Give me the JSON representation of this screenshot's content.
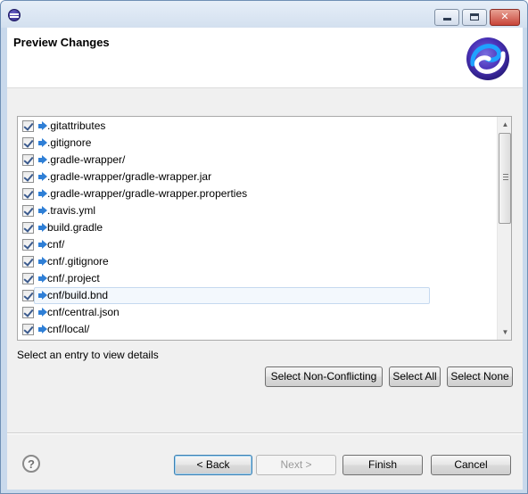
{
  "window": {
    "close_glyph": "✕",
    "title_icon": "eclipse-icon",
    "controls": [
      "minimize",
      "maximize",
      "close"
    ]
  },
  "header": {
    "title": "Preview Changes",
    "logo_icon": "wizard-logo-icon"
  },
  "tree": {
    "items": [
      {
        "label": ".gitattributes",
        "checked": true
      },
      {
        "label": ".gitignore",
        "checked": true
      },
      {
        "label": ".gradle-wrapper/",
        "checked": true
      },
      {
        "label": ".gradle-wrapper/gradle-wrapper.jar",
        "checked": true
      },
      {
        "label": ".gradle-wrapper/gradle-wrapper.properties",
        "checked": true
      },
      {
        "label": ".travis.yml",
        "checked": true
      },
      {
        "label": "build.gradle",
        "checked": true
      },
      {
        "label": "cnf/",
        "checked": true
      },
      {
        "label": "cnf/.gitignore",
        "checked": true
      },
      {
        "label": "cnf/.project",
        "checked": true
      },
      {
        "label": "cnf/build.bnd",
        "checked": true,
        "selected": true
      },
      {
        "label": "cnf/central.json",
        "checked": true
      },
      {
        "label": "cnf/local/",
        "checked": true
      }
    ],
    "scroll_up_glyph": "▲",
    "scroll_down_glyph": "▼"
  },
  "status": {
    "text": "Select an entry to view details"
  },
  "selection_buttons": {
    "select_non_conflicting": "Select Non-Conflicting",
    "select_all": "Select All",
    "select_none": "Select None"
  },
  "footer": {
    "help_glyph": "?",
    "back": "< Back",
    "next": "Next >",
    "finish": "Finish",
    "cancel": "Cancel"
  },
  "colors": {
    "accent_blue": "#2f7fd6",
    "selection_bg": "#f3f8fd",
    "frame": "#c9d9ec"
  }
}
